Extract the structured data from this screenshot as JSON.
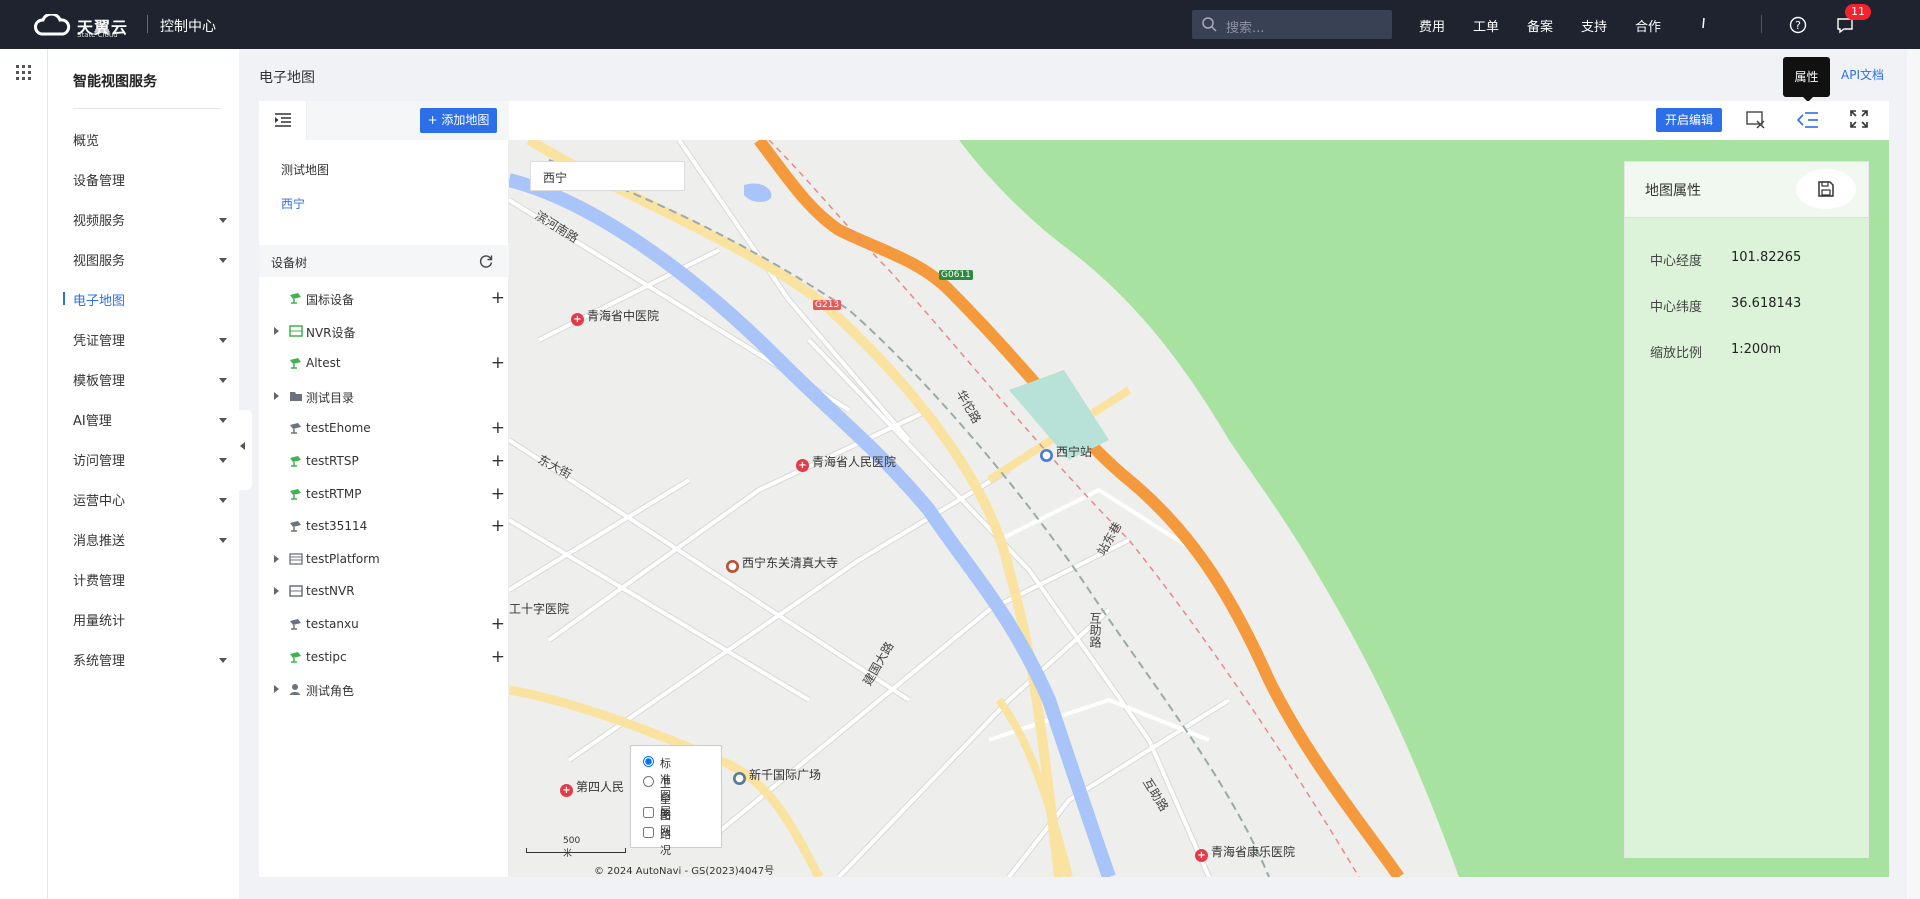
{
  "topbar": {
    "brand": "天翼云",
    "brand_sub": "State Cloud",
    "console": "控制中心",
    "search_placeholder": "搜索...",
    "nav": [
      "费用",
      "工单",
      "备案",
      "支持",
      "合作"
    ],
    "notif_count": "11"
  },
  "sidenav": {
    "title": "智能视图服务",
    "items": [
      {
        "label": "概览",
        "expandable": false,
        "active": false
      },
      {
        "label": "设备管理",
        "expandable": false,
        "active": false
      },
      {
        "label": "视频服务",
        "expandable": true,
        "active": false
      },
      {
        "label": "视图服务",
        "expandable": true,
        "active": false
      },
      {
        "label": "电子地图",
        "expandable": false,
        "active": true
      },
      {
        "label": "凭证管理",
        "expandable": true,
        "active": false
      },
      {
        "label": "模板管理",
        "expandable": true,
        "active": false
      },
      {
        "label": "AI管理",
        "expandable": true,
        "active": false
      },
      {
        "label": "访问管理",
        "expandable": true,
        "active": false
      },
      {
        "label": "运营中心",
        "expandable": true,
        "active": false
      },
      {
        "label": "消息推送",
        "expandable": true,
        "active": false
      },
      {
        "label": "计费管理",
        "expandable": false,
        "active": false
      },
      {
        "label": "用量统计",
        "expandable": false,
        "active": false
      },
      {
        "label": "系统管理",
        "expandable": true,
        "active": false
      }
    ]
  },
  "page": {
    "breadcrumb": "电子地图",
    "api_doc": "API文档",
    "tooltip": "属性"
  },
  "leftpanel": {
    "add_map": "+ 添加地图",
    "maps": [
      {
        "label": "测试地图",
        "selected": false
      },
      {
        "label": "西宁",
        "selected": true
      }
    ],
    "tree_title": "设备树",
    "tree": [
      {
        "label": "国标设备",
        "expandable": false,
        "icon": "camera-green-icon",
        "plus": true
      },
      {
        "label": "NVR设备",
        "expandable": true,
        "icon": "nvr-green-icon",
        "plus": false
      },
      {
        "label": "Altest",
        "expandable": false,
        "icon": "camera-green-icon",
        "plus": true
      },
      {
        "label": "测试目录",
        "expandable": true,
        "icon": "folder-icon",
        "plus": false
      },
      {
        "label": "testEhome",
        "expandable": false,
        "icon": "camera-gray-icon",
        "plus": true
      },
      {
        "label": "testRTSP",
        "expandable": false,
        "icon": "camera-green-icon",
        "plus": true
      },
      {
        "label": "testRTMP",
        "expandable": false,
        "icon": "camera-green-icon",
        "plus": true
      },
      {
        "label": "test35114",
        "expandable": false,
        "icon": "camera-gray-icon",
        "plus": true
      },
      {
        "label": "testPlatform",
        "expandable": true,
        "icon": "platform-icon",
        "plus": false
      },
      {
        "label": "testNVR",
        "expandable": true,
        "icon": "nvr-gray-icon",
        "plus": false
      },
      {
        "label": "testanxu",
        "expandable": false,
        "icon": "camera-gray-icon",
        "plus": true
      },
      {
        "label": "testipc",
        "expandable": false,
        "icon": "camera-green-icon",
        "plus": true
      },
      {
        "label": "测试角色",
        "expandable": true,
        "icon": "role-icon",
        "plus": false
      }
    ]
  },
  "toolbar": {
    "edit": "开启编辑"
  },
  "map": {
    "search_value": "西宁",
    "pois": [
      "青海省中医院",
      "青海省人民医院",
      "西宁站",
      "西宁东关清真大寺",
      "工十字医院",
      "新千国际广场",
      "第四人民",
      "青海省康乐医院"
    ],
    "roads": [
      "滨河南路",
      "东大街",
      "互助路",
      "站东巷",
      "互助路",
      "建国大路",
      "华佗路",
      "G0611",
      "G213"
    ],
    "layers": {
      "standard": "标准图层",
      "satellite": "卫星图",
      "roadnet": "路网",
      "traffic": "路况",
      "selected": "standard"
    },
    "scale": "500 米",
    "copyright": "© 2024 AutoNavi - GS(2023)4047号"
  },
  "props": {
    "title": "地图属性",
    "rows": [
      {
        "label": "中心经度",
        "value": "101.82265"
      },
      {
        "label": "中心纬度",
        "value": "36.618143"
      },
      {
        "label": "缩放比例",
        "value": "1:200m"
      }
    ]
  },
  "colors": {
    "accent": "#2d6fe8",
    "topbar": "#1f2330",
    "park": "#a8e2a0",
    "highway": "#f59a3c",
    "river": "#a8c4f8"
  }
}
